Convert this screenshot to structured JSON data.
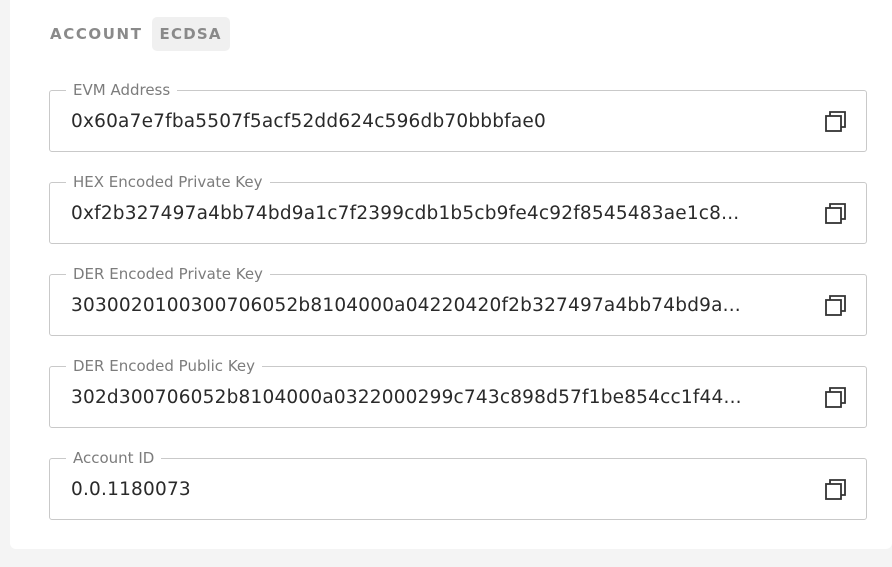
{
  "header": {
    "title": "ACCOUNT",
    "badge": "ECDSA"
  },
  "fields": [
    {
      "label": "EVM Address",
      "value": "0x60a7e7fba5507f5acf52dd624c596db70bbbfae0",
      "action_icon": "copy-icon"
    },
    {
      "label": "HEX Encoded Private Key",
      "value": "0xf2b327497a4bb74bd9a1c7f2399cdb1b5cb9fe4c92f8545483ae1c8...",
      "action_icon": "copy-icon"
    },
    {
      "label": "DER Encoded Private Key",
      "value": "3030020100300706052b8104000a04220420f2b327497a4bb74bd9a...",
      "action_icon": "copy-icon"
    },
    {
      "label": "DER Encoded Public Key",
      "value": "302d300706052b8104000a0322000299c743c898d57f1be854cc1f44...",
      "action_icon": "copy-icon"
    },
    {
      "label": "Account ID",
      "value": "0.0.1180073",
      "action_icon": "copy-icon"
    }
  ]
}
